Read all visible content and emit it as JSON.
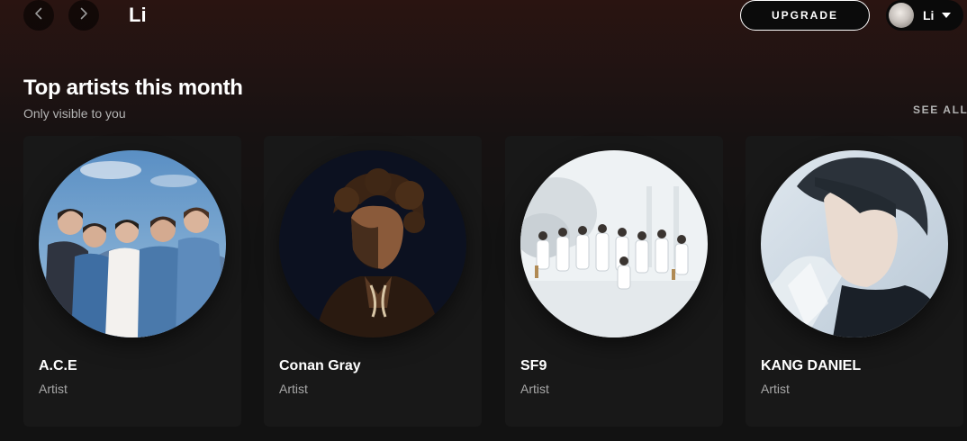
{
  "header": {
    "title": "Li",
    "upgrade_label": "UPGRADE",
    "user_name": "Li",
    "back_icon": "chevron-left-icon",
    "forward_icon": "chevron-right-icon"
  },
  "section": {
    "title": "Top artists this month",
    "subtitle": "Only visible to you",
    "see_all": "SEE ALL"
  },
  "artists": [
    {
      "name": "A.C.E",
      "type": "Artist"
    },
    {
      "name": "Conan Gray",
      "type": "Artist"
    },
    {
      "name": "SF9",
      "type": "Artist"
    },
    {
      "name": "KANG DANIEL",
      "type": "Artist"
    }
  ],
  "colors": {
    "background": "#121212",
    "card": "#181818",
    "secondary_text": "#b3b3b3",
    "header_tint": "#2a1411"
  }
}
